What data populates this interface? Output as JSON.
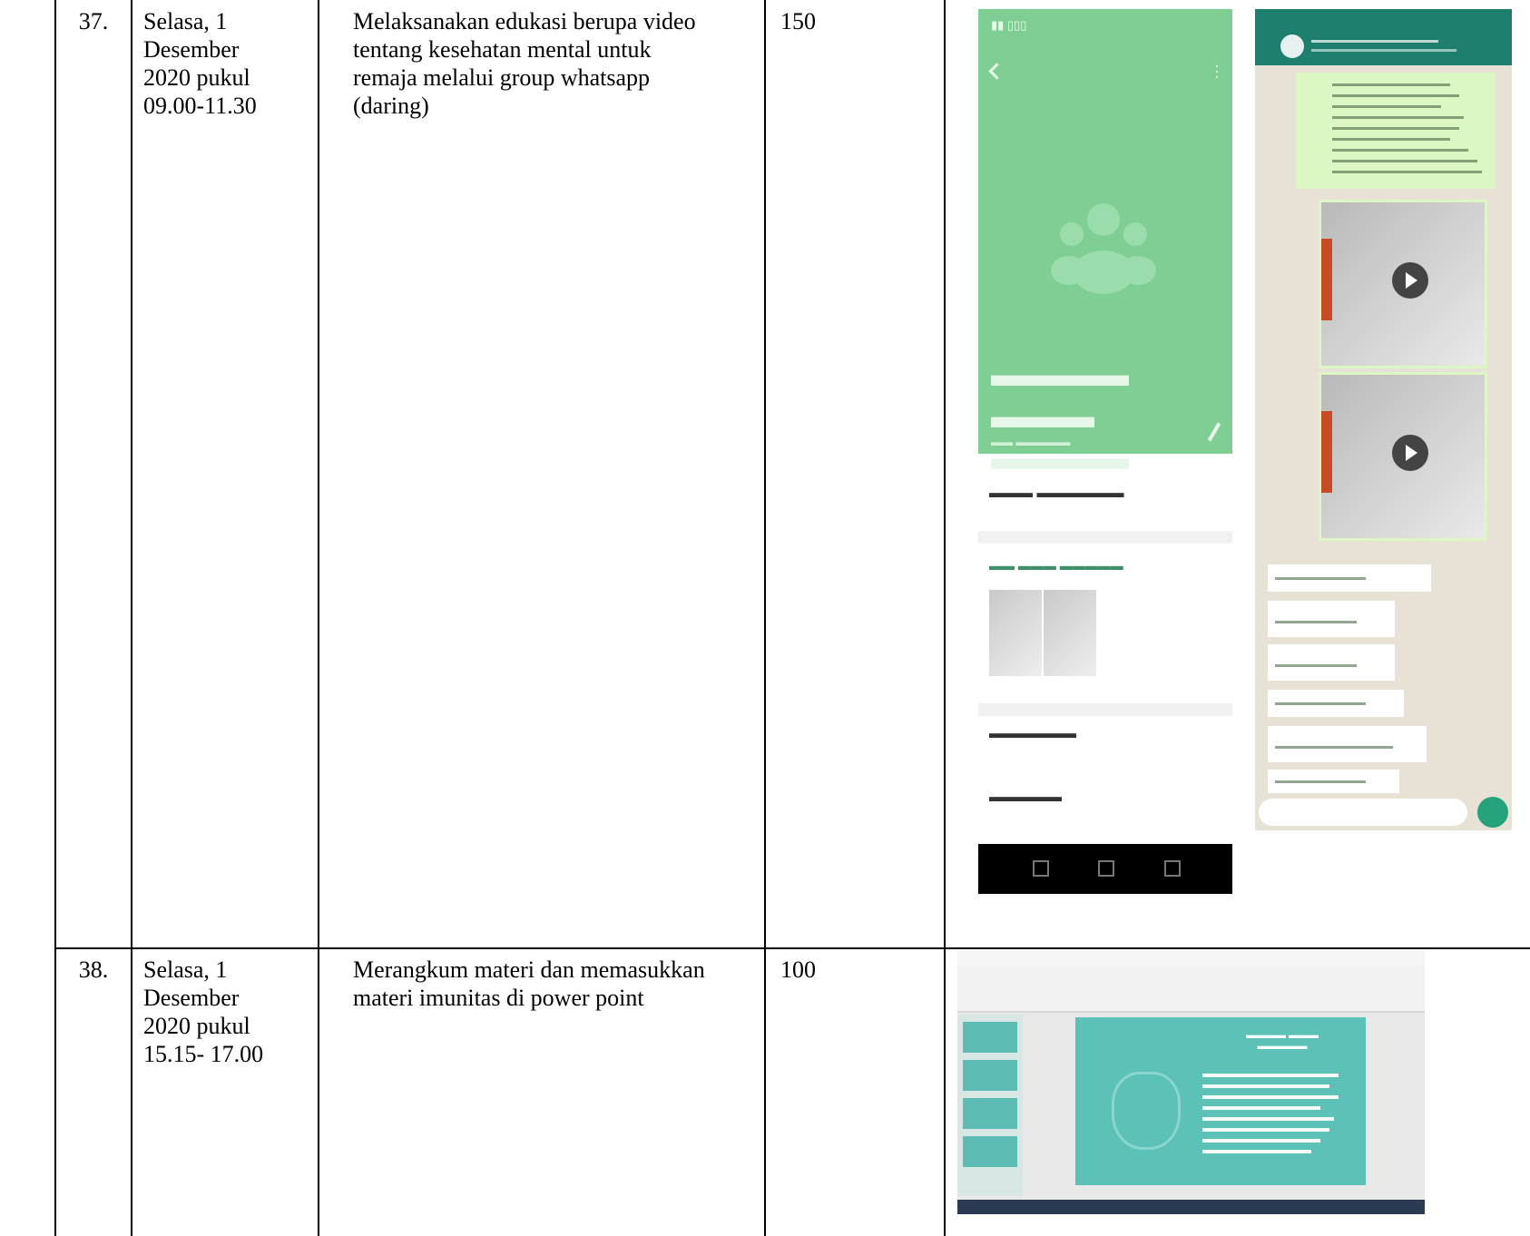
{
  "rows": [
    {
      "no": "37.",
      "date_line1": "Selasa, 1",
      "date_line2": "Desember",
      "date_line3": "2020 pukul",
      "date_line4": "09.00-11.30",
      "activity_line1": "Melaksanakan edukasi berupa video",
      "activity_line2": "tentang kesehatan mental untuk",
      "activity_line3": "remaja melalui group whatsapp",
      "activity_line4": "(daring)",
      "minutes": "150",
      "evidence_icons": [
        "whatsapp-group-info-screenshot",
        "whatsapp-chat-screenshot"
      ]
    },
    {
      "no": "38.",
      "date_line1": "Selasa, 1",
      "date_line2": "Desember",
      "date_line3": "2020 pukul",
      "date_line4": "15.15- 17.00",
      "activity_line1": "Merangkum materi dan memasukkan",
      "activity_line2": "materi imunitas di power point",
      "minutes": "100",
      "evidence_icons": [
        "powerpoint-screenshot"
      ]
    }
  ],
  "colors": {
    "wa_green_header": "#7fcf95",
    "wa_chat_bg": "#e7e1d6",
    "wa_bubble": "#dcf7c3",
    "ppt_slide": "#5cc2b8"
  }
}
